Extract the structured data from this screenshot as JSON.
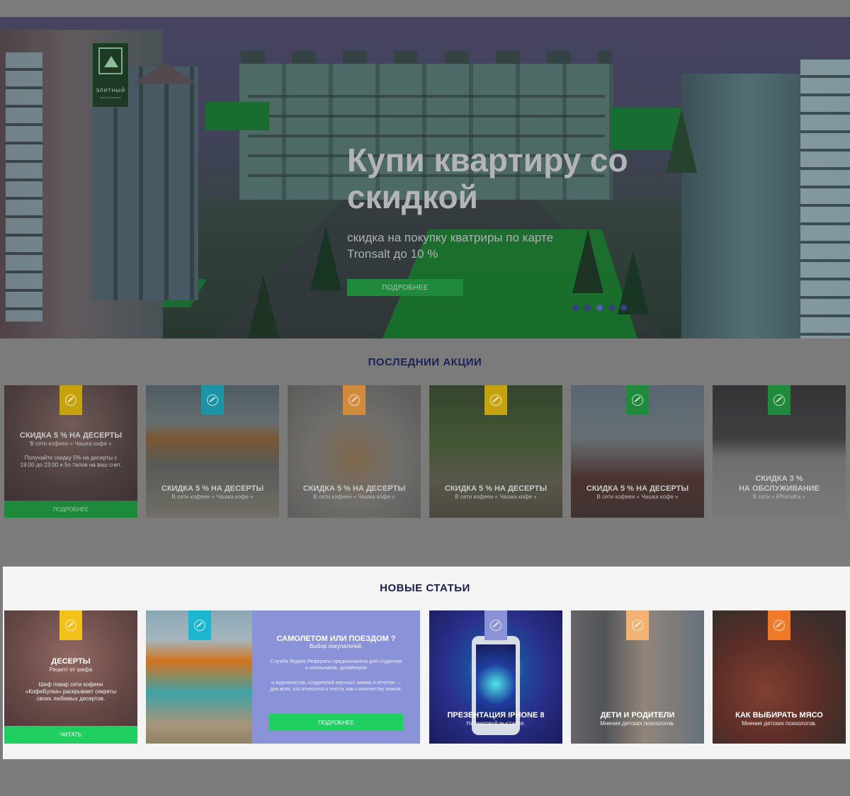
{
  "hero": {
    "logo_line1": "ЭЛИТНЫЙ",
    "logo_line2": "жилой комплекс",
    "title": "Купи квартиру со скидкой",
    "subtitle": "скидка на покупку кватриры по карте Tronsalt до 10 %",
    "button": "ПОДРОБНЕЕ",
    "slides_count": 5,
    "active_slide": 2
  },
  "promos": {
    "title": "ПОСЛЕДНИИ АКЦИИ",
    "items": [
      {
        "title": "СКИДКА 5 % НА ДЕСЕРТЫ",
        "sub": "В сети кофеен « Чашка кофе »",
        "desc": "Получайте скидку  5% на десерты с 19:00 до 23:00 и 5о талов на ваш счет.",
        "button": "ПОДРОБНЕЕ",
        "tag_color": "#c7a20f"
      },
      {
        "title": "СКИДКА 5 % НА ДЕСЕРТЫ",
        "sub": "В сети кофеен « Чашка кофе »",
        "tag_color": "#1d93a6"
      },
      {
        "title": "СКИДКА 5 % НА ДЕСЕРТЫ",
        "sub": "В сети кофеен « Чашка кофе »",
        "tag_color": "#d18b3a"
      },
      {
        "title": "СКИДКА 5 % НА ДЕСЕРТЫ",
        "sub": "В сети кофеен « Чашка кофе »",
        "tag_color": "#c7a20f"
      },
      {
        "title": "СКИДКА 5 % НА ДЕСЕРТЫ",
        "sub": "В сети кофеен « Чашка кофе »",
        "tag_color": "#1f8a3c"
      },
      {
        "title_line1": "СКИДКА 3 %",
        "title_line2": "НА ОБСЛУЖИВАНИЕ",
        "sub": "В сети « iPhoneKa »",
        "tag_color": "#1f8a3c"
      }
    ]
  },
  "articles": {
    "title": "НОВЫЕ СТАТЬИ",
    "items": [
      {
        "title": "ДЕСЕРТЫ",
        "sub": "Рецепт от шефа",
        "desc": "Шеф повар сети кофеен «КофеБулка» раскрывает секреты своих любимых десертов.",
        "button": "ЧИТАТЬ",
        "tag_color": "#f2c21a"
      },
      {
        "tag_color": "#1bb7d0"
      },
      {
        "title": "ПРЕЗЕНТАЦИЯ IPHONE 8",
        "sub": "На мировой выставке.",
        "tag_color": "#8a92d8"
      },
      {
        "title": "ДЕТИ И РОДИТЕЛИ",
        "sub": "Мнение детских психологов.",
        "tag_color": "#f1b273"
      },
      {
        "title": "КАК ВЫБИРАТЬ МЯСО",
        "sub": "Мнение детских психологов.",
        "tag_color": "#f07a2a"
      }
    ],
    "featured": {
      "title": "САМОЛЕТОМ ИЛИ ПОЕЗДОМ ?",
      "sub": "Выбор покупателей.",
      "desc1": "Служба Яндекс.Рефераты предназначена для студентов и школьников, дизайнеров",
      "desc2": "и журналистов, создателей научных заявок и отчетов — для всех, кто относится к тексту, как к количеству знаков.",
      "button": "ПОДРОБНЕЕ"
    }
  }
}
